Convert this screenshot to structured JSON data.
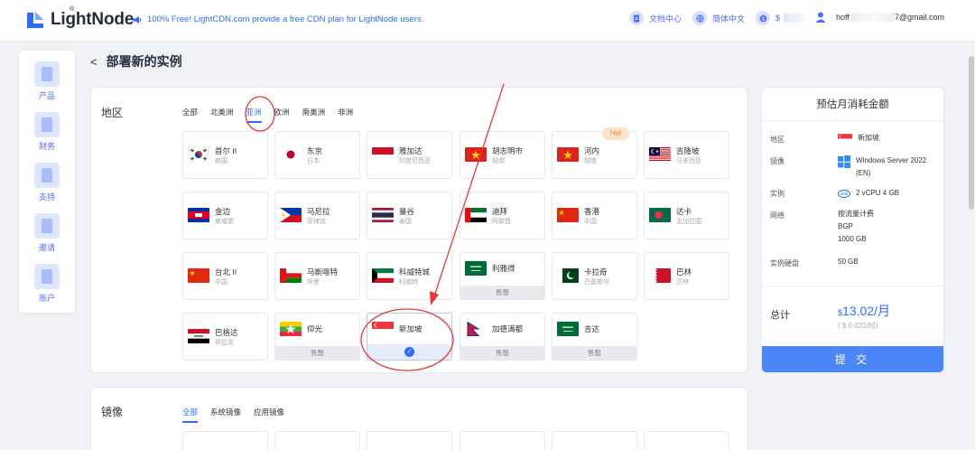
{
  "topbar": {
    "logo_text": "LightNode",
    "logo_reg": "®",
    "notice": "100% Free! LightCDN.com provide a free CDN plan for LightNode users.",
    "docs_label": "文档中心",
    "lang_label": "简体中文",
    "balance_prefix": "$",
    "user_email_start": "hoff",
    "user_email_end": "7@gmail.com"
  },
  "sidebar": {
    "items": [
      {
        "label": "产品",
        "icon": "product-icon"
      },
      {
        "label": "财务",
        "icon": "finance-icon"
      },
      {
        "label": "支持",
        "icon": "support-icon"
      },
      {
        "label": "邀请",
        "icon": "invite-icon"
      },
      {
        "label": "账户",
        "icon": "account-icon"
      }
    ]
  },
  "page": {
    "back": "<",
    "title": "部署新的实例"
  },
  "region_section": {
    "label": "地区",
    "tabs": [
      "全部",
      "北美洲",
      "亚洲",
      "欧洲",
      "南美洲",
      "非洲"
    ],
    "active_tab": "亚洲",
    "hot_badge": "Hot",
    "sold_out": "售罄",
    "check": "✓",
    "regions": [
      {
        "name": "首尔 II",
        "sub": "韩国"
      },
      {
        "name": "东京",
        "sub": "日本"
      },
      {
        "name": "雅加达",
        "sub": "印度尼西亚"
      },
      {
        "name": "胡志明市",
        "sub": "越南"
      },
      {
        "name": "河内",
        "sub": "越南"
      },
      {
        "name": "吉隆坡",
        "sub": "马来西亚"
      },
      {
        "name": "金边",
        "sub": "柬埔寨"
      },
      {
        "name": "马尼拉",
        "sub": "菲律宾"
      },
      {
        "name": "曼谷",
        "sub": "泰国"
      },
      {
        "name": "迪拜",
        "sub": "阿联酋"
      },
      {
        "name": "香港",
        "sub": "中国"
      },
      {
        "name": "达卡",
        "sub": "孟加拉国"
      },
      {
        "name": "台北 II",
        "sub": "中国"
      },
      {
        "name": "马斯喀特",
        "sub": "阿曼"
      },
      {
        "name": "科威特城",
        "sub": "科威特"
      },
      {
        "name": "利雅得",
        "sub": ""
      },
      {
        "name": "卡拉奇",
        "sub": "巴基斯坦"
      },
      {
        "name": "巴林",
        "sub": "巴林"
      },
      {
        "name": "巴格达",
        "sub": "伊拉克"
      },
      {
        "name": "仰光",
        "sub": ""
      },
      {
        "name": "新加坡",
        "sub": ""
      },
      {
        "name": "加德满都",
        "sub": ""
      },
      {
        "name": "吉达",
        "sub": ""
      }
    ]
  },
  "image_section": {
    "label": "镜像",
    "tabs": [
      "全部",
      "系统镜像",
      "应用镜像"
    ],
    "active_tab": "全部"
  },
  "price": {
    "title": "预估月消耗金额",
    "region_label": "地区",
    "region_value": "新加坡",
    "image_label": "镜像",
    "image_value_1": "Windows Server 2022",
    "image_value_2": "(EN)",
    "instance_label": "实例",
    "instance_value": "2 vCPU 4 GB",
    "network_label": "网络",
    "network_value_1": "按流量计费",
    "network_value_2": "BGP",
    "network_value_3": "1000 GB",
    "disk_label": "实例硬盘",
    "disk_value": "50 GB",
    "total_label": "总计",
    "total_currency": "$",
    "total_value": "13.02/月",
    "total_sub": "( $ 0.020/时)",
    "submit_label": "提 交"
  },
  "colors": {
    "accent": "#2f6bff",
    "submit": "#4a86f7",
    "annotation": "#e53935"
  }
}
